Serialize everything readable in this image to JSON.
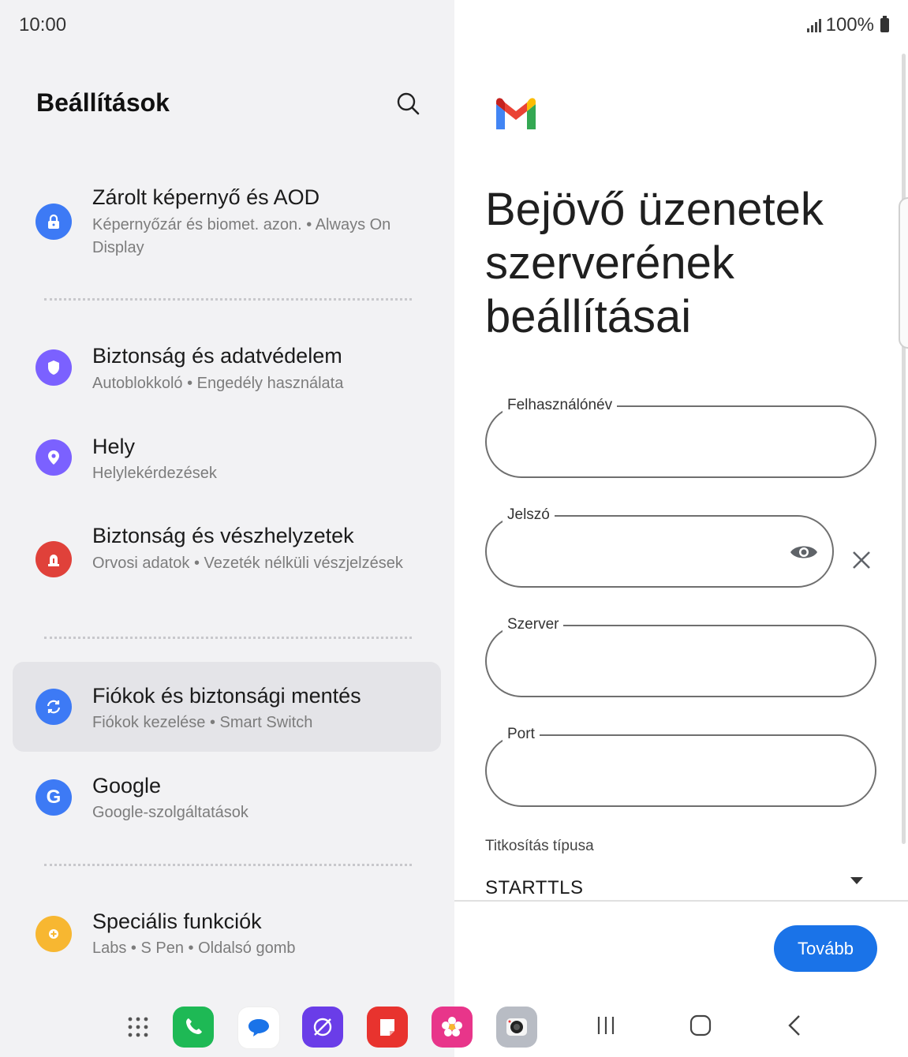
{
  "status_bar": {
    "time": "10:00",
    "battery": "100%"
  },
  "settings": {
    "title": "Beállítások",
    "items": [
      {
        "title": "Zárolt képernyő és AOD",
        "subtitle": "Képernyőzár és biomet. azon.  •  Always On Display",
        "icon": "lock-icon",
        "color": "#3d7af5"
      },
      {
        "title": "Biztonság és adatvédelem",
        "subtitle": "Autoblokkoló  •  Engedély használata",
        "icon": "shield-icon",
        "color": "#7b61ff"
      },
      {
        "title": "Hely",
        "subtitle": "Helylekérdezések",
        "icon": "location-pin-icon",
        "color": "#7b61ff"
      },
      {
        "title": "Biztonság és vészhelyzetek",
        "subtitle": "Orvosi adatok  •  Vezeték nélküli vészjelzések",
        "icon": "emergency-siren-icon",
        "color": "#e0413a"
      },
      {
        "title": "Fiókok és biztonsági mentés",
        "subtitle": "Fiókok kezelése  •  Smart Switch",
        "icon": "sync-icon",
        "color": "#3d7af5"
      },
      {
        "title": "Google",
        "subtitle": "Google-szolgáltatások",
        "icon": "google-g-icon",
        "color": "#3d7af5"
      },
      {
        "title": "Speciális funkciók",
        "subtitle": "Labs  •  S Pen  •  Oldalsó gomb",
        "icon": "gear-plus-icon",
        "color": "#f7b731"
      }
    ]
  },
  "mail_setup": {
    "heading": "Bejövő üzenetek szerverének beállításai",
    "fields": {
      "username_label": "Felhasználónév",
      "password_label": "Jelszó",
      "server_label": "Szerver",
      "port_label": "Port"
    },
    "encryption_label": "Titkosítás típusa",
    "encryption_value": "STARTTLS",
    "next_button": "Tovább"
  },
  "dock": [
    "apps-grid-icon",
    "phone-icon",
    "messages-icon",
    "browser-icon",
    "notes-icon",
    "gallery-icon",
    "camera-icon"
  ],
  "colors": {
    "accent": "#1a73e8",
    "selected_item_bg": "#e4e4e8"
  }
}
